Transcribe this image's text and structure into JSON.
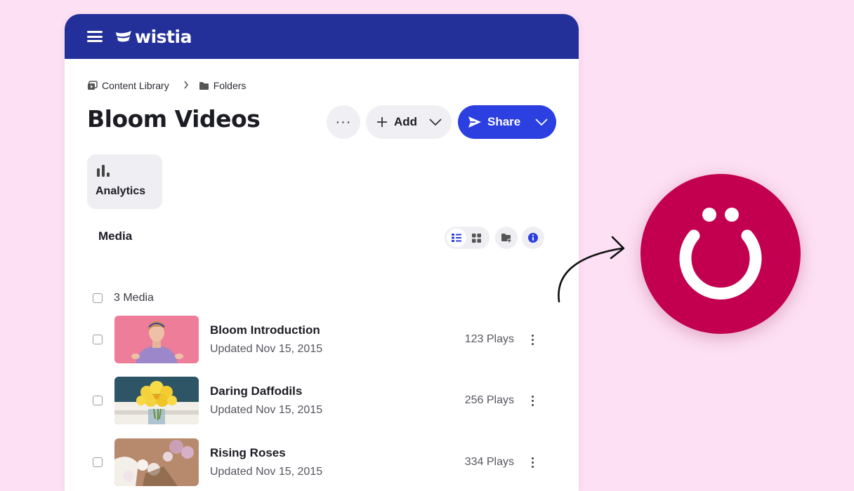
{
  "header": {
    "logo_text": "wistia",
    "bg_color": "#23309a"
  },
  "breadcrumb": {
    "items": [
      {
        "label": "Content Library",
        "icon": "video-library-icon"
      },
      {
        "label": "Folders",
        "icon": "folder-icon"
      }
    ]
  },
  "page": {
    "title": "Bloom Videos"
  },
  "actions": {
    "more_label": "···",
    "add_label": "Add",
    "share_label": "Share",
    "share_color": "#2c3fe0"
  },
  "analytics": {
    "label": "Analytics",
    "icon": "bar-chart-icon"
  },
  "media": {
    "heading": "Media",
    "count_label": "3 Media",
    "view_icons": [
      "list-view-icon",
      "grid-view-icon",
      "new-folder-icon",
      "info-icon"
    ],
    "items": [
      {
        "title": "Bloom Introduction",
        "updated": "Updated Nov 15, 2015",
        "plays": "123 Plays"
      },
      {
        "title": "Daring Daffodils",
        "updated": "Updated Nov 15, 2015",
        "plays": "256 Plays"
      },
      {
        "title": "Rising Roses",
        "updated": "Updated Nov 15, 2015",
        "plays": "334 Plays"
      }
    ]
  },
  "colors": {
    "background": "#fde0f4",
    "badge": "#c2004f"
  }
}
